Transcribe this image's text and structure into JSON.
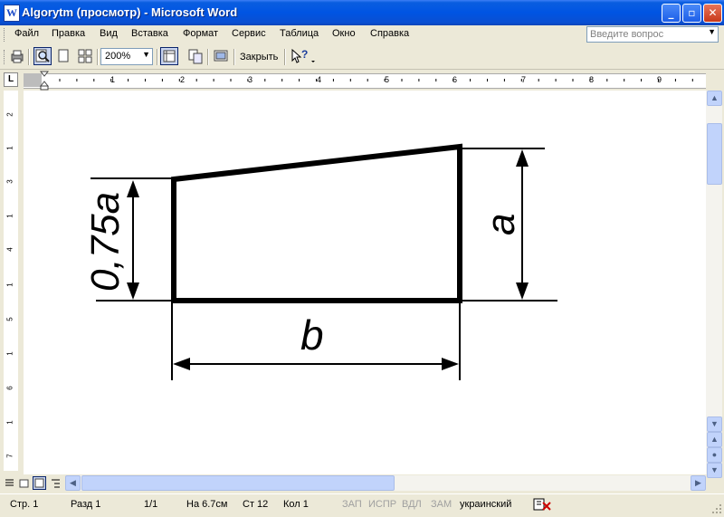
{
  "window": {
    "title": "Algorytm (просмотр) - Microsoft Word",
    "app_icon_letter": "W"
  },
  "menu": {
    "items": [
      "Файл",
      "Правка",
      "Вид",
      "Вставка",
      "Формат",
      "Сервис",
      "Таблица",
      "Окно",
      "Справка"
    ],
    "ask_placeholder": "Введите вопрос"
  },
  "toolbar": {
    "zoom": "200%",
    "close_label": "Закрыть"
  },
  "ruler": {
    "corner": "L",
    "h_numbers": [
      "1",
      "1",
      "2",
      "3",
      "4",
      "5",
      "6",
      "7",
      "8",
      "9"
    ],
    "v_numbers": [
      "2",
      "1",
      "3",
      "1",
      "4",
      "1",
      "5",
      "1",
      "6",
      "1",
      "7"
    ]
  },
  "drawing": {
    "label_height_left": "0,75a",
    "label_height_right": "a",
    "label_width": "b"
  },
  "statusbar": {
    "page": "Стр. 1",
    "section": "Разд 1",
    "pages": "1/1",
    "at": "На 6.7см",
    "line": "Ст  12",
    "col": "Кол  1",
    "rec": "ЗАП",
    "trk": "ИСПР",
    "ext": "ВДЛ",
    "ovr": "ЗАМ",
    "language": "украинский"
  },
  "colors": {
    "title_bar": "#0054e3",
    "chrome": "#ece9d8"
  }
}
